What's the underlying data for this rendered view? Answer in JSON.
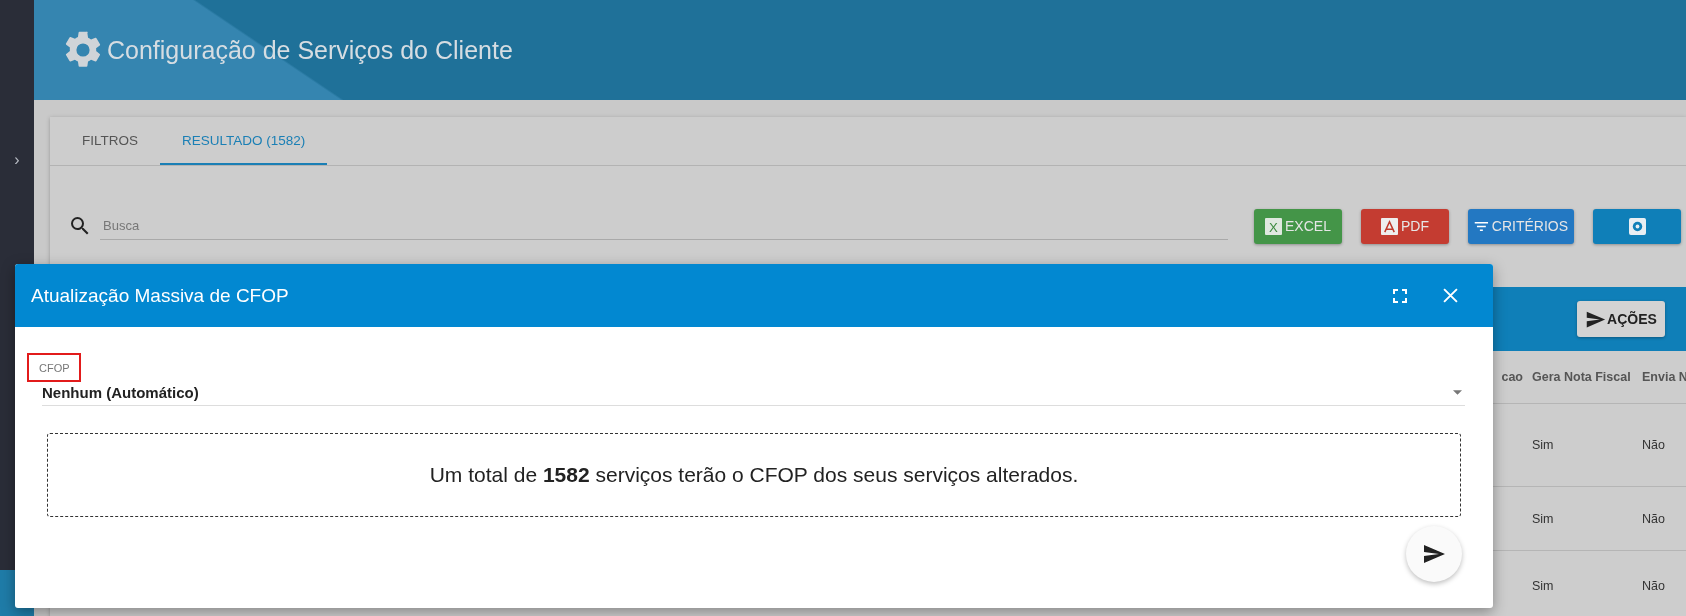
{
  "sidebar": {
    "toggle": "›"
  },
  "header": {
    "title": "Configuração de Serviços do Cliente"
  },
  "tabs": [
    {
      "label": "FILTROS",
      "selected": false
    },
    {
      "label": "RESULTADO (1582)",
      "selected": true
    }
  ],
  "search": {
    "placeholder": "Busca"
  },
  "toolbar_buttons": [
    {
      "kind": "excel",
      "label": "EXCEL",
      "icon_letter": "X"
    },
    {
      "kind": "pdf",
      "label": "PDF"
    },
    {
      "kind": "criteria",
      "label": "CRITÉRIOS"
    },
    {
      "kind": "settings"
    }
  ],
  "table": {
    "actions_button": "AÇÕES",
    "columns": [
      "cao",
      "Gera Nota Fiscal",
      "Envia N"
    ],
    "rows": [
      [
        "",
        "Sim",
        "Não"
      ],
      [
        "",
        "Sim",
        "Não"
      ],
      [
        "",
        "Sim",
        "Não"
      ]
    ]
  },
  "modal": {
    "title": "Atualização Massiva de CFOP",
    "field": {
      "label": "CFOP",
      "value": "Nenhum (Automático)",
      "highlighted": true
    },
    "message": "Um total de **1582** serviços terão o CFOP dos seus serviços alterados."
  }
}
